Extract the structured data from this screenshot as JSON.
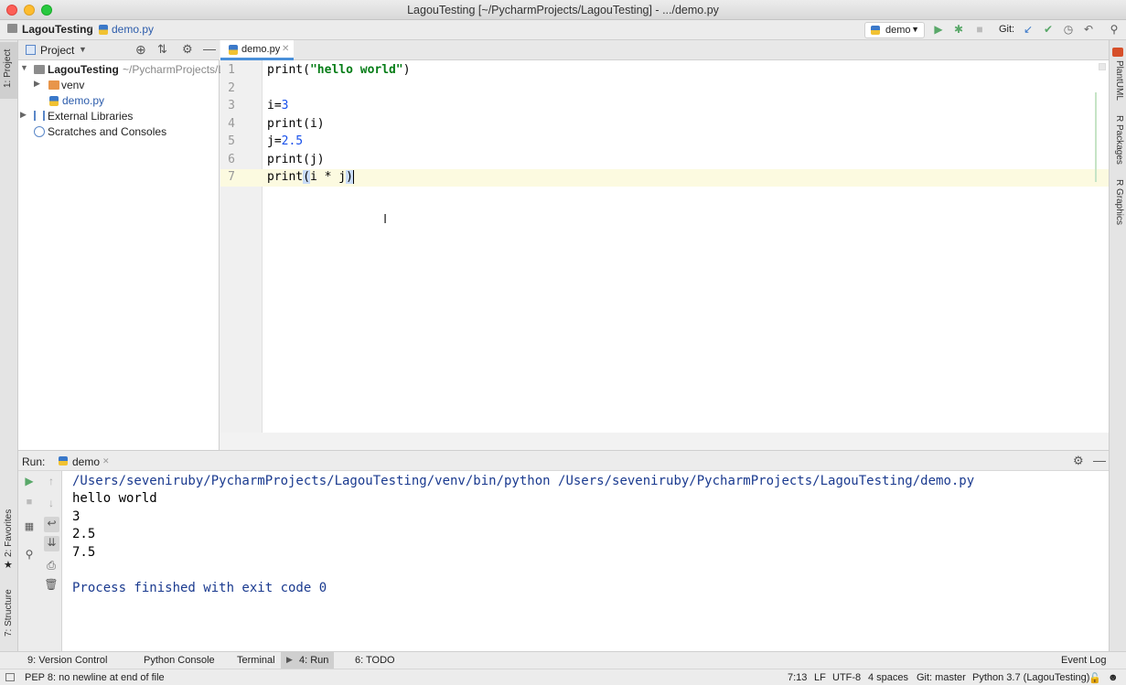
{
  "window": {
    "title": "LagouTesting [~/PycharmProjects/LagouTesting] - .../demo.py"
  },
  "navbar": {
    "project": "LagouTesting",
    "file": "demo.py",
    "run_config": "demo",
    "git_label": "Git:"
  },
  "project_panel": {
    "title": "Project",
    "tree": [
      {
        "label": "LagouTesting",
        "path": "~/PycharmProjects/L"
      },
      {
        "label": "venv"
      },
      {
        "label": "demo.py"
      },
      {
        "label": "External Libraries"
      },
      {
        "label": "Scratches and Consoles"
      }
    ]
  },
  "left_strip": {
    "project": "1: Project",
    "favorites": "2: Favorites",
    "structure": "7: Structure"
  },
  "right_strip": {
    "plantuml": "PlantUML",
    "r_packages": "R Packages",
    "r_graphics": "R Graphics"
  },
  "editor": {
    "tab": "demo.py",
    "line_numbers": [
      "1",
      "2",
      "3",
      "4",
      "5",
      "6",
      "7"
    ]
  },
  "run_panel": {
    "label": "Run:",
    "tab": "demo",
    "output": [
      "/Users/seveniruby/PycharmProjects/LagouTesting/venv/bin/python /Users/seveniruby/PycharmProjects/LagouTesting/demo.py",
      "hello world",
      "3",
      "2.5",
      "7.5",
      "",
      "Process finished with exit code 0"
    ]
  },
  "tool_tabs": {
    "version_control": "9: Version Control",
    "python_console": "Python Console",
    "terminal": "Terminal",
    "run": "4: Run",
    "todo": "6: TODO",
    "event_log": "Event Log"
  },
  "status": {
    "message": "PEP 8: no newline at end of file",
    "position": "7:13",
    "line_sep": "LF",
    "encoding": "UTF-8",
    "indent": "4 spaces",
    "git": "Git: master",
    "interpreter": "Python 3.7 (LagouTesting)"
  },
  "colors": {
    "accent": "#4a90d9",
    "run_green": "#59a869",
    "string_green": "#067d17",
    "number_blue": "#1750eb"
  }
}
